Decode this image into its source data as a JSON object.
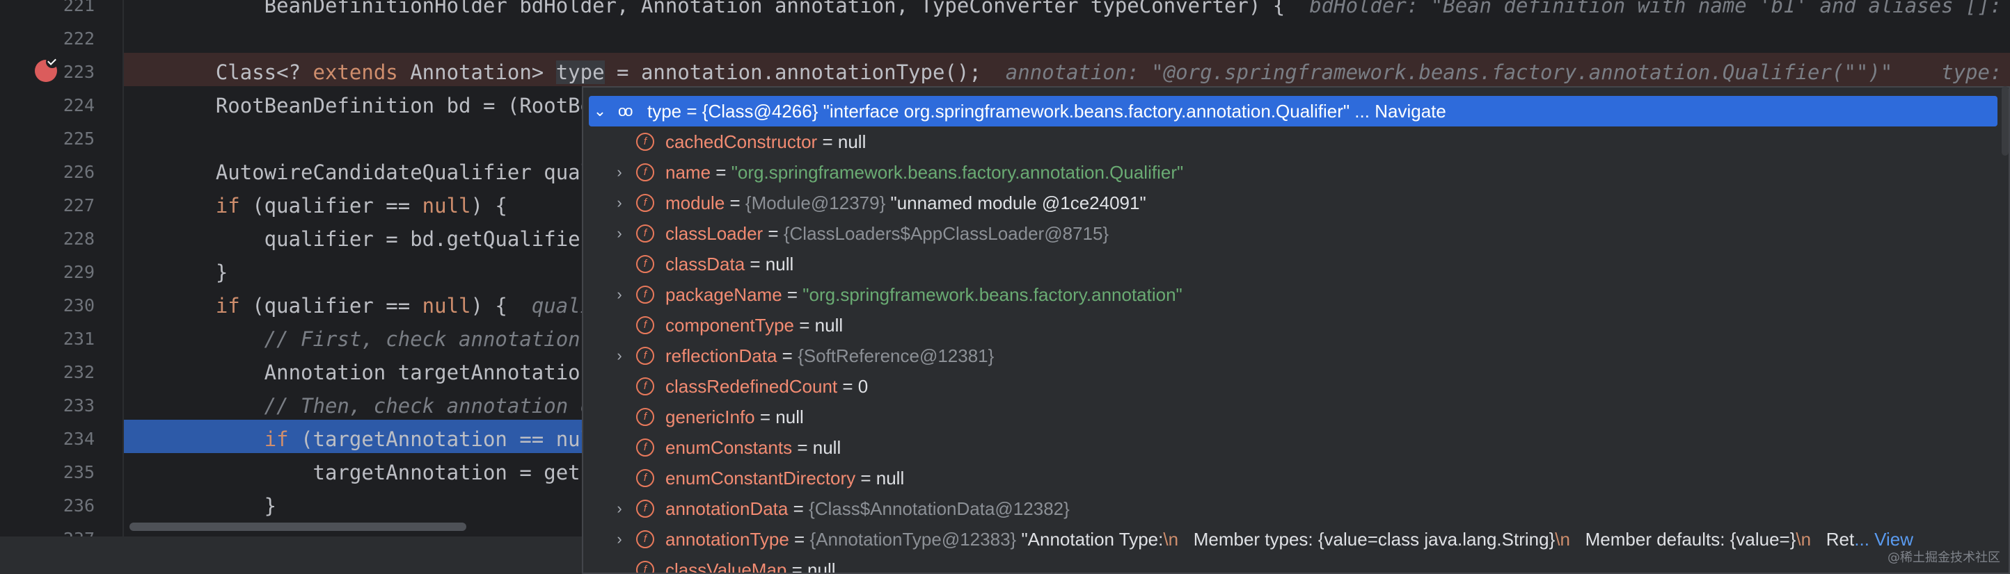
{
  "editor": {
    "lines": [
      {
        "num": "221",
        "parts": [
          {
            "t": "        BeanDefinitionHolder bdHolder, Annotation annotation, TypeConverter typeConverter) {  ",
            "c": ""
          },
          {
            "t": "bdHolder: \"Bean definition with name 'b1' and aliases []: R",
            "c": "hint"
          }
        ]
      },
      {
        "num": "222",
        "parts": []
      },
      {
        "num": "223",
        "parts": [
          {
            "t": "    Class<? ",
            "c": ""
          },
          {
            "t": "extends",
            "c": "kw"
          },
          {
            "t": " Annotation> ",
            "c": ""
          },
          {
            "t": "type",
            "c": "var-hl"
          },
          {
            "t": " = annotation.annotationType();  ",
            "c": ""
          },
          {
            "t": "annotation: \"@org.springframework.beans.factory.annotation.Qualifier(\"\")\"    type: \"",
            "c": "hint"
          }
        ]
      },
      {
        "num": "224",
        "parts": [
          {
            "t": "    RootBeanDefinition bd = (RootBe",
            "c": ""
          }
        ]
      },
      {
        "num": "225",
        "parts": []
      },
      {
        "num": "226",
        "parts": [
          {
            "t": "    AutowireCandidateQualifier qual",
            "c": ""
          }
        ]
      },
      {
        "num": "227",
        "parts": [
          {
            "t": "    ",
            "c": ""
          },
          {
            "t": "if",
            "c": "kw"
          },
          {
            "t": " (qualifier == ",
            "c": ""
          },
          {
            "t": "null",
            "c": "kw"
          },
          {
            "t": ") {",
            "c": ""
          }
        ]
      },
      {
        "num": "228",
        "parts": [
          {
            "t": "        qualifier = bd.getQualifier",
            "c": ""
          }
        ]
      },
      {
        "num": "229",
        "parts": [
          {
            "t": "    }",
            "c": ""
          }
        ]
      },
      {
        "num": "230",
        "parts": [
          {
            "t": "    ",
            "c": ""
          },
          {
            "t": "if",
            "c": "kw"
          },
          {
            "t": " (qualifier == ",
            "c": ""
          },
          {
            "t": "null",
            "c": "kw"
          },
          {
            "t": ") {  ",
            "c": ""
          },
          {
            "t": "quali",
            "c": "hint"
          }
        ]
      },
      {
        "num": "231",
        "parts": [
          {
            "t": "        // First, check annotation ",
            "c": "cm"
          }
        ]
      },
      {
        "num": "232",
        "parts": [
          {
            "t": "        Annotation targetAnnotation",
            "c": ""
          }
        ]
      },
      {
        "num": "233",
        "parts": [
          {
            "t": "        // Then, check annotation o",
            "c": "cm"
          }
        ]
      },
      {
        "num": "234",
        "parts": [
          {
            "t": "        ",
            "c": ""
          },
          {
            "t": "if",
            "c": "kw"
          },
          {
            "t": " (targetAnnotation == nul",
            "c": ""
          }
        ]
      },
      {
        "num": "235",
        "parts": [
          {
            "t": "            targetAnnotation = getF",
            "c": ""
          }
        ]
      },
      {
        "num": "236",
        "parts": [
          {
            "t": "        }",
            "c": ""
          }
        ]
      },
      {
        "num": "237",
        "parts": []
      }
    ]
  },
  "debug_popup": {
    "root": {
      "icon": "watch-glasses-icon",
      "name": "type",
      "value": " = {Class@4266} \"interface org.springframework.beans.factory.annotation.Qualifier\" ... ",
      "link": "Navigate"
    },
    "fields": [
      {
        "expandable": false,
        "name": "cachedConstructor",
        "eq": " = ",
        "ref": "",
        "val": "null",
        "kind": "plain"
      },
      {
        "expandable": true,
        "name": "name",
        "eq": " = ",
        "ref": "",
        "val": "\"org.springframework.beans.factory.annotation.Qualifier\"",
        "kind": "str"
      },
      {
        "expandable": true,
        "name": "module",
        "eq": " = ",
        "ref": "{Module@12379} ",
        "val": "\"unnamed module @1ce24091\"",
        "kind": "plain"
      },
      {
        "expandable": true,
        "name": "classLoader",
        "eq": " = ",
        "ref": "{ClassLoaders$AppClassLoader@8715}",
        "val": "",
        "kind": "plain"
      },
      {
        "expandable": false,
        "name": "classData",
        "eq": " = ",
        "ref": "",
        "val": "null",
        "kind": "plain"
      },
      {
        "expandable": true,
        "name": "packageName",
        "eq": " = ",
        "ref": "",
        "val": "\"org.springframework.beans.factory.annotation\"",
        "kind": "str"
      },
      {
        "expandable": false,
        "name": "componentType",
        "eq": " = ",
        "ref": "",
        "val": "null",
        "kind": "plain"
      },
      {
        "expandable": true,
        "name": "reflectionData",
        "eq": " = ",
        "ref": "{SoftReference@12381}",
        "val": "",
        "kind": "plain"
      },
      {
        "expandable": false,
        "name": "classRedefinedCount",
        "eq": " = ",
        "ref": "",
        "val": "0",
        "kind": "plain"
      },
      {
        "expandable": false,
        "name": "genericInfo",
        "eq": " = ",
        "ref": "",
        "val": "null",
        "kind": "plain"
      },
      {
        "expandable": false,
        "name": "enumConstants",
        "eq": " = ",
        "ref": "",
        "val": "null",
        "kind": "plain"
      },
      {
        "expandable": false,
        "name": "enumConstantDirectory",
        "eq": " = ",
        "ref": "",
        "val": "null",
        "kind": "plain"
      },
      {
        "expandable": true,
        "name": "annotationData",
        "eq": " = ",
        "ref": "{Class$AnnotationData@12382}",
        "val": "",
        "kind": "plain"
      },
      {
        "expandable": true,
        "name": "annotationType",
        "eq": " = ",
        "ref": "{AnnotationType@12383} ",
        "val": "",
        "kind": "annot",
        "segments": [
          {
            "t": "\"Annotation Type:",
            "c": "white"
          },
          {
            "t": "\\n",
            "c": "esc"
          },
          {
            "t": "   Member types: {value=class java.lang.String}",
            "c": "white"
          },
          {
            "t": "\\n",
            "c": "esc"
          },
          {
            "t": "   Member defaults: {value=}",
            "c": "white"
          },
          {
            "t": "\\n",
            "c": "esc"
          },
          {
            "t": "   Ret",
            "c": "white"
          },
          {
            "t": "... View",
            "c": "link"
          }
        ]
      },
      {
        "expandable": false,
        "name": "classValueMap",
        "eq": " = ",
        "ref": "",
        "val": "null",
        "kind": "plain"
      }
    ]
  },
  "watermark": "@稀土掘金技术社区",
  "colors": {
    "accent": "#2e6bdb",
    "breakpoint": "#db5c5c",
    "exec_line": "#2d5aa8",
    "field_icon": "#e8795b",
    "string": "#6aab73",
    "keyword": "#cf8e6d"
  }
}
